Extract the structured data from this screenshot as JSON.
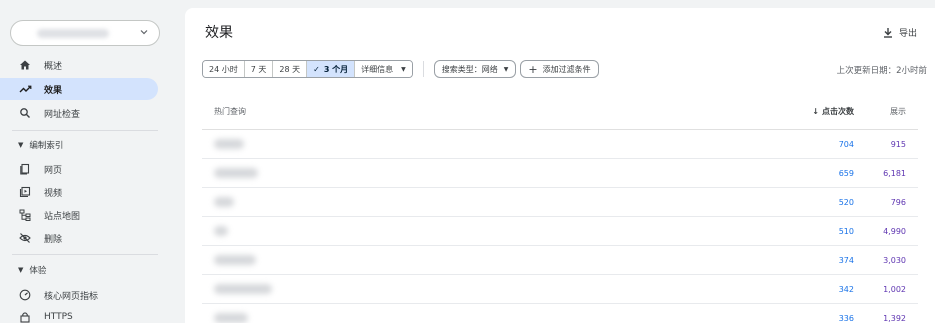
{
  "sidebar": {
    "nav": [
      {
        "label": "概述",
        "icon": "home-icon"
      },
      {
        "label": "效果",
        "icon": "trending-icon",
        "active": true
      },
      {
        "label": "网址检查",
        "icon": "search-icon"
      }
    ],
    "index_section": {
      "label": "编制索引",
      "items": [
        {
          "label": "网页",
          "icon": "pages-icon"
        },
        {
          "label": "视频",
          "icon": "video-icon"
        },
        {
          "label": "站点地图",
          "icon": "sitemap-icon"
        },
        {
          "label": "删除",
          "icon": "removal-icon"
        }
      ]
    },
    "experience_section": {
      "label": "体验",
      "items": [
        {
          "label": "核心网页指标",
          "icon": "gauge-icon"
        },
        {
          "label": "HTTPS",
          "icon": "lock-icon"
        }
      ]
    }
  },
  "header": {
    "title": "效果",
    "export_label": "导出"
  },
  "filters": {
    "ranges": [
      "24 小时",
      "7 天",
      "28 天",
      "3 个月"
    ],
    "selected_range": "3 个月",
    "details_label": "详细信息",
    "search_type_label": "搜索类型：网络",
    "add_filter_label": "添加过滤条件"
  },
  "updated_text": "上次更新日期：2小时前",
  "table": {
    "headers": {
      "query": "热门查询",
      "clicks": "点击次数",
      "impressions": "展示"
    },
    "rows": [
      {
        "clicks": "704",
        "impressions": "915"
      },
      {
        "clicks": "659",
        "impressions": "6,181"
      },
      {
        "clicks": "520",
        "impressions": "796"
      },
      {
        "clicks": "510",
        "impressions": "4,990"
      },
      {
        "clicks": "374",
        "impressions": "3,030"
      },
      {
        "clicks": "342",
        "impressions": "1,002"
      },
      {
        "clicks": "336",
        "impressions": "1,392"
      }
    ]
  },
  "colors": {
    "accent": "#1a73e8",
    "impressions": "#5e35b1",
    "active_nav": "#d3e3fd"
  }
}
